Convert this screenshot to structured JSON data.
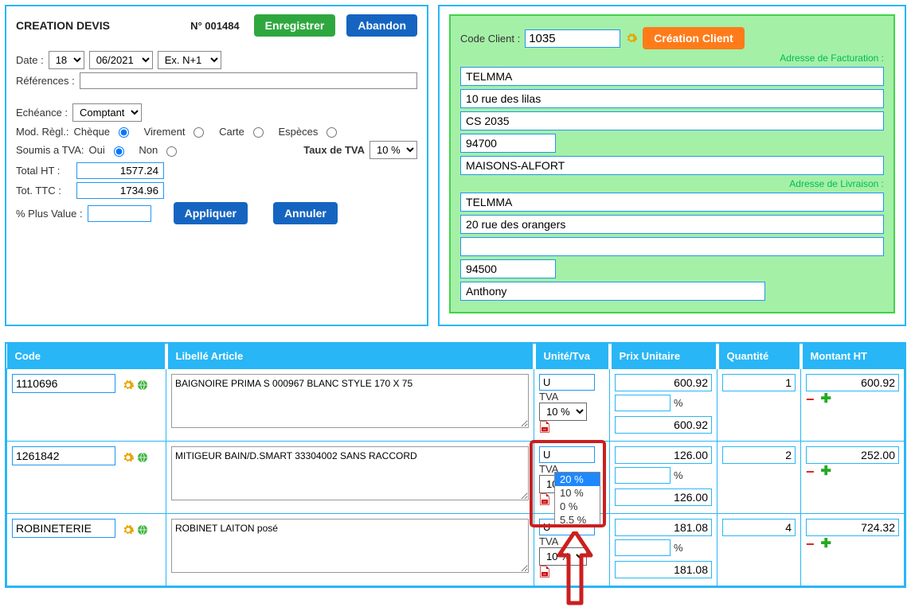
{
  "header": {
    "title": "CREATION DEVIS",
    "num_prefix": "N°",
    "num": "001484",
    "save": "Enregistrer",
    "cancel": "Abandon"
  },
  "left": {
    "date_label": "Date :",
    "date_day": "18",
    "date_month": "06/2021",
    "date_ex": "Ex. N+1",
    "ref_label": "Références :",
    "ref_value": "",
    "echeance_label": "Echéance :",
    "echeance_value": "Comptant",
    "modregl_label": "Mod. Règl.:",
    "pay_cheque": "Chèque",
    "pay_virement": "Virement",
    "pay_carte": "Carte",
    "pay_especes": "Espèces",
    "tva_label": "Soumis a TVA:",
    "tva_oui": "Oui",
    "tva_non": "Non",
    "taux_label": "Taux de TVA",
    "taux_value": "10 %",
    "total_ht_label": "Total HT :",
    "total_ht": "1577.24",
    "total_ttc_label": "Tot. TTC :",
    "total_ttc": "1734.96",
    "plusvalue_label": "% Plus Value :",
    "plusvalue": "",
    "apply": "Appliquer",
    "cancel2": "Annuler"
  },
  "client": {
    "code_label": "Code Client :",
    "code": "1035",
    "create": "Création Client",
    "facturation_label": "Adresse de Facturation :",
    "fact": [
      "TELMMA",
      "10 rue des lilas",
      "CS 2035",
      "94700",
      "MAISONS-ALFORT"
    ],
    "livraison_label": "Adresse de Livraison :",
    "livr": [
      "TELMMA",
      "20 rue des orangers",
      "",
      "94500",
      "Anthony"
    ]
  },
  "table": {
    "headers": {
      "code": "Code",
      "libelle": "Libellé Article",
      "unite": "Unité/Tva",
      "pu": "Prix Unitaire",
      "qte": "Quantité",
      "ht": "Montant HT"
    },
    "tva_short": "TVA",
    "pct_sign": "%",
    "rows": [
      {
        "code": "1110696",
        "libelle": "BAIGNOIRE PRIMA S 000967 BLANC STYLE 170 X 75",
        "unite": "U",
        "tva": "10 %",
        "pu": "600.92",
        "pct": "",
        "pu2": "600.92",
        "qte": "1",
        "ht": "600.92"
      },
      {
        "code": "1261842",
        "libelle": "MITIGEUR BAIN/D.SMART 33304002 SANS RACCORD",
        "unite": "U",
        "tva": "10 %",
        "pu": "126.00",
        "pct": "",
        "pu2": "126.00",
        "qte": "2",
        "ht": "252.00"
      },
      {
        "code": "ROBINETERIE",
        "libelle": "ROBINET LAITON posé",
        "unite": "U",
        "tva": "10 %",
        "pu": "181.08",
        "pct": "",
        "pu2": "181.08",
        "qte": "4",
        "ht": "724.32"
      }
    ]
  },
  "tva_options": [
    "20 %",
    "10 %",
    "0 %",
    "5.5 %"
  ]
}
